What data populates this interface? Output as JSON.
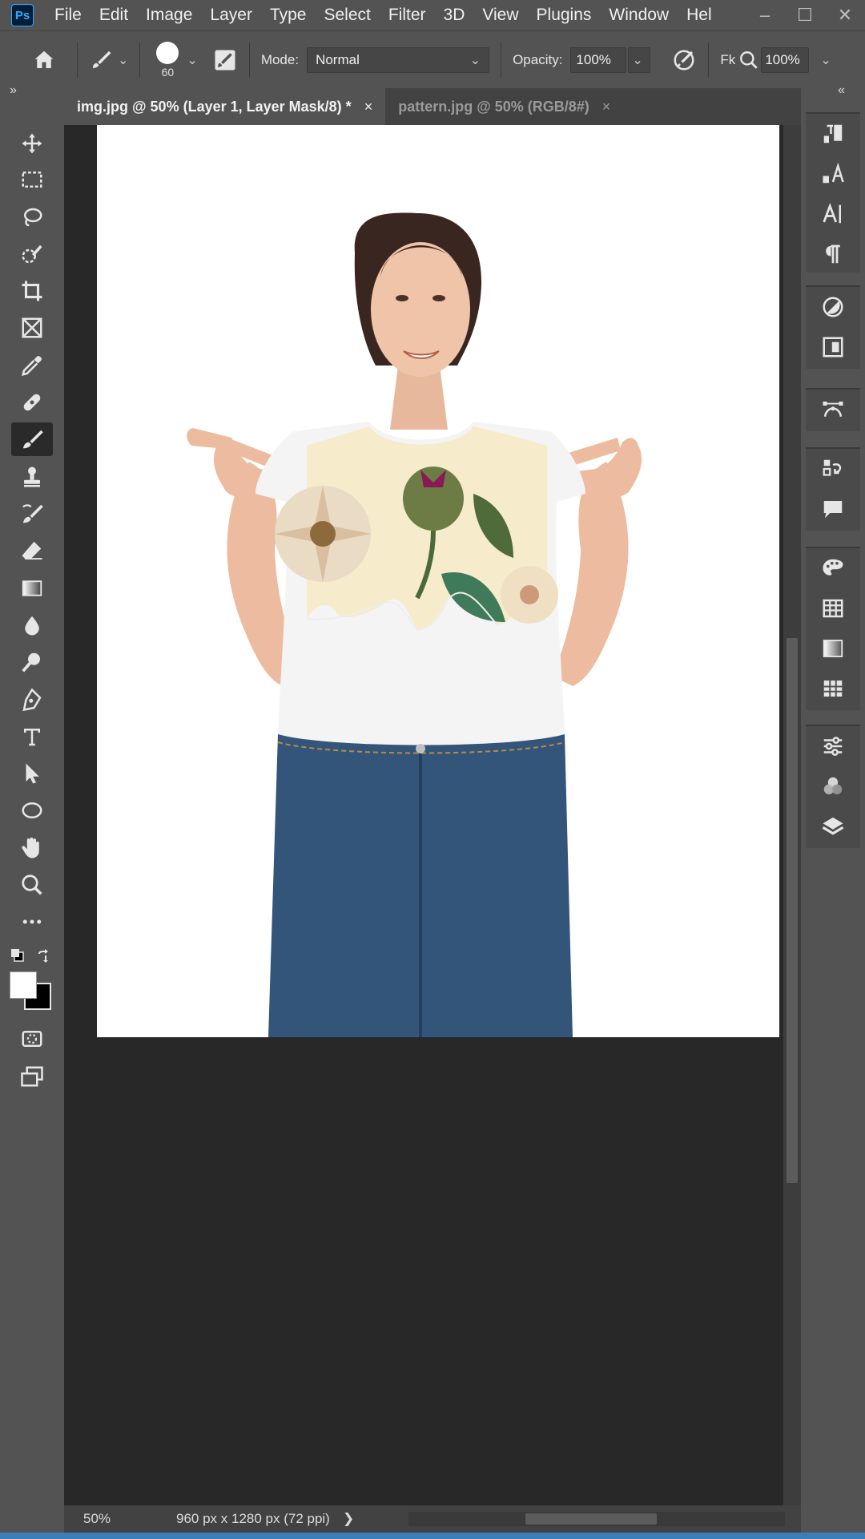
{
  "app": {
    "logo_text": "Ps",
    "accent": "#31a8ff"
  },
  "menu": {
    "items": [
      "File",
      "Edit",
      "Image",
      "Layer",
      "Type",
      "Select",
      "Filter",
      "3D",
      "View",
      "Plugins",
      "Window",
      "Hel"
    ]
  },
  "window_controls": {
    "minimize": "–",
    "maximize": "☐",
    "close": "✕"
  },
  "options": {
    "brush_size": "60",
    "mode_label": "Mode:",
    "mode_value": "Normal",
    "opacity_label": "Opacity:",
    "opacity_value": "100%",
    "flow_label": "Fk",
    "zoom_value": "100%"
  },
  "tabs": [
    {
      "label": "img.jpg @ 50% (Layer 1, Layer Mask/8) *",
      "close": "×",
      "active": true
    },
    {
      "label": "pattern.jpg @ 50% (RGB/8#)",
      "close": "×",
      "active": false
    }
  ],
  "panel_toggles": {
    "left": "»",
    "right": "«"
  },
  "status": {
    "zoom": "50%",
    "doc_info": "960 px x 1280 px (72 ppi)",
    "arrow": "❯"
  },
  "colors": {
    "foreground": "#ffffff",
    "background": "#000000",
    "ui_dark": "#282828",
    "ui_panel": "#535353"
  }
}
